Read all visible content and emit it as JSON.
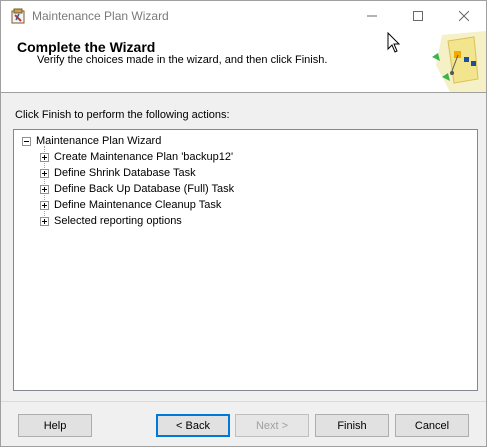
{
  "window": {
    "title": "Maintenance Plan Wizard",
    "icon": "wizard-app-icon",
    "controls": {
      "minimize": "minimize-icon",
      "maximize": "maximize-icon",
      "close": "close-icon"
    }
  },
  "header": {
    "title": "Complete the Wizard",
    "subtitle": "Verify the choices made in the wizard, and then click Finish."
  },
  "body": {
    "intro": "Click Finish to perform the following actions:",
    "tree": {
      "root": "Maintenance Plan Wizard",
      "items": [
        "Create Maintenance Plan 'backup12'",
        "Define Shrink Database Task",
        "Define Back Up Database (Full) Task",
        "Define Maintenance Cleanup Task",
        "Selected reporting options"
      ]
    }
  },
  "footer": {
    "help": "Help",
    "back": "< Back",
    "next": "Next >",
    "finish": "Finish",
    "cancel": "Cancel"
  }
}
